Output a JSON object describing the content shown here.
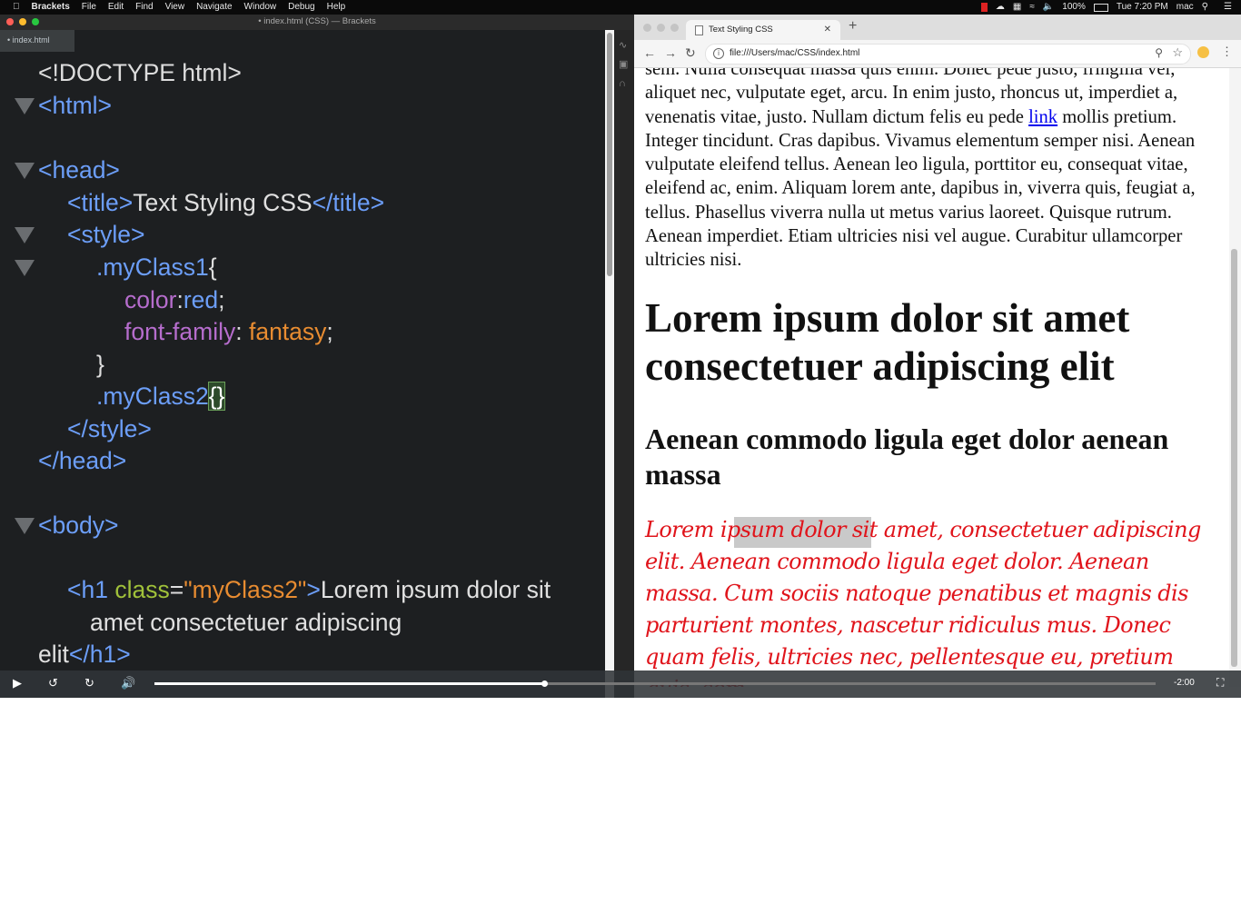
{
  "menubar": {
    "items": [
      "Brackets",
      "File",
      "Edit",
      "Find",
      "View",
      "Navigate",
      "Window",
      "Debug",
      "Help"
    ],
    "battery": "100%",
    "clock": "Tue 7:20 PM",
    "user": "mac"
  },
  "brackets": {
    "window_title": "• index.html (CSS) — Brackets",
    "working_file": "index.html"
  },
  "code": {
    "l1": "<!DOCTYPE html>",
    "html_open": "<html>",
    "head_open": "<head>",
    "title_open": "<title>",
    "title_text": "Text Styling CSS",
    "title_close": "</title>",
    "style_open": "<style>",
    "class1": ".myClass1",
    "brace_open": "{",
    "prop_color": "color",
    "colon": ":",
    "val_red": "red",
    "semi": ";",
    "prop_font": "font-family",
    "colon_sp": ": ",
    "val_fantasy": "fantasy",
    "brace_close": "}",
    "class2": ".myClass2",
    "braces": "{}",
    "style_close": "</style>",
    "head_close": "</head>",
    "body_open": "<body>",
    "h1_open": "<h1 ",
    "attr_class": "class",
    "eq": "=",
    "attr_val": "\"myClass2\"",
    "gt": ">",
    "h1_text1": "Lorem ipsum dolor sit",
    "h1_text2": "amet consectetuer adipiscing",
    "h1_text3": "elit",
    "h1_close": "</h1>"
  },
  "browser": {
    "tab_title": "Text Styling CSS",
    "url": "file:///Users/mac/CSS/index.html",
    "para1_a": "sem. Nulla consequat massa quis enim. Donec pede justo, fringilla vel, aliquet nec, vulputate eget, arcu. In enim justo, rhoncus ut, imperdiet a, venenatis vitae, justo. Nullam dictum felis eu pede ",
    "link_text": "link",
    "para1_b": " mollis pretium. Integer tincidunt. Cras dapibus. Vivamus elementum semper nisi. Aenean vulputate eleifend tellus. Aenean leo ligula, porttitor eu, consequat vitae, eleifend ac, enim. Aliquam lorem ante, dapibus in, viverra quis, feugiat a, tellus. Phasellus viverra nulla ut metus varius laoreet. Quisque rutrum. Aenean imperdiet. Etiam ultricies nisi vel augue. Curabitur ullamcorper ultricies nisi.",
    "h1": "Lorem ipsum dolor sit amet consectetuer adipiscing elit",
    "h2": "Aenean commodo ligula eget dolor aenean massa",
    "para2": "Lorem ipsum dolor sit amet, consectetuer adipiscing elit. Aenean commodo ligula eget dolor. Aenean massa. Cum sociis natoque penatibus et magnis dis parturient montes, nascetur ridiculus mus. Donec quam felis, ultricies nec, pellentesque eu, pretium quis, sem."
  },
  "player": {
    "time_remaining": "-2:00",
    "progress": 0.39
  },
  "colors": {
    "tag": "#6c9ef8",
    "attr": "#a0c13a",
    "string": "#e88c31",
    "property": "#b66dcd",
    "fantasy_text": "#e0141b"
  }
}
